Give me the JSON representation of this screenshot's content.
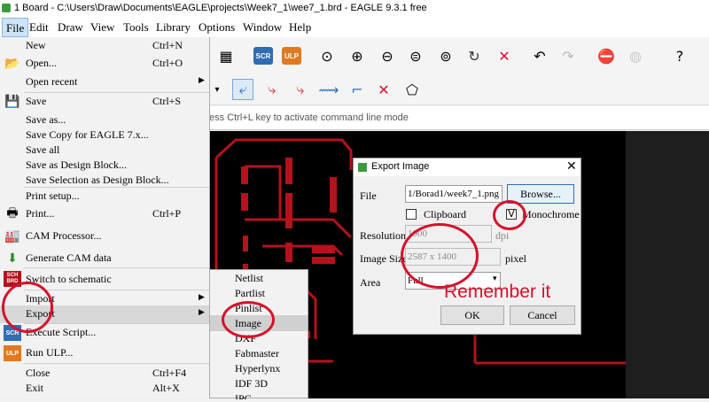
{
  "titlebar": {
    "title": "1 Board - C:\\Users\\Draw\\Documents\\EAGLE\\projects\\Week7_1\\wee7_1.brd - EAGLE 9.3.1 free"
  },
  "menubar": {
    "items": [
      "File",
      "Edit",
      "Draw",
      "View",
      "Tools",
      "Library",
      "Options",
      "Window",
      "Help"
    ]
  },
  "toolbar1": {
    "scr_label": "SCR",
    "ulp_label": "ULP"
  },
  "command_hint": "ess Ctrl+L key to activate command line mode",
  "file_menu": {
    "new": {
      "label": "New",
      "shortcut": "Ctrl+N"
    },
    "open": {
      "label": "Open...",
      "shortcut": "Ctrl+O"
    },
    "open_recent": "Open recent",
    "save": {
      "label": "Save",
      "shortcut": "Ctrl+S"
    },
    "save_as": "Save as...",
    "save_copy": "Save Copy for EAGLE 7.x...",
    "save_all": "Save all",
    "save_design_block": "Save as Design Block...",
    "save_selection": "Save Selection as Design Block...",
    "print_setup": "Print setup...",
    "print": {
      "label": "Print...",
      "shortcut": "Ctrl+P"
    },
    "cam_processor": "CAM Processor...",
    "generate_cam": "Generate CAM data",
    "switch_schematic": "Switch to schematic",
    "sch_badge": "SCH BRD",
    "import": "Import",
    "export": "Export",
    "execute_script": "Execute Script...",
    "run_ulp": "Run ULP...",
    "close": {
      "label": "Close",
      "shortcut": "Ctrl+F4"
    },
    "exit": {
      "label": "Exit",
      "shortcut": "Alt+X"
    }
  },
  "export_menu": {
    "items": [
      "Netlist",
      "Partlist",
      "Pinlist",
      "Image",
      "DXF",
      "Fabmaster",
      "Hyperlynx",
      "IDF 3D",
      "IPC"
    ]
  },
  "dialog": {
    "title": "Export Image",
    "file_label": "File",
    "file_value": "1/Borad1/week7_1.png",
    "browse": "Browse...",
    "clipboard": "Clipboard",
    "monochrome": "Monochrome",
    "resolution_label": "Resolution",
    "resolution_value": "1000",
    "resolution_unit": "dpi",
    "image_size_label": "Image Size",
    "image_size_value": "2587 x 1400",
    "image_size_unit": "pixel",
    "area_label": "Area",
    "area_value": "Full",
    "ok": "OK",
    "cancel": "Cancel",
    "monochrome_checked": "V"
  },
  "annotation": "Remember it",
  "colors": {
    "annotation_red": "#d6102b",
    "trace_red": "#b5121b",
    "scr_blue": "#2f6db5",
    "ulp_orange": "#e07a22"
  }
}
